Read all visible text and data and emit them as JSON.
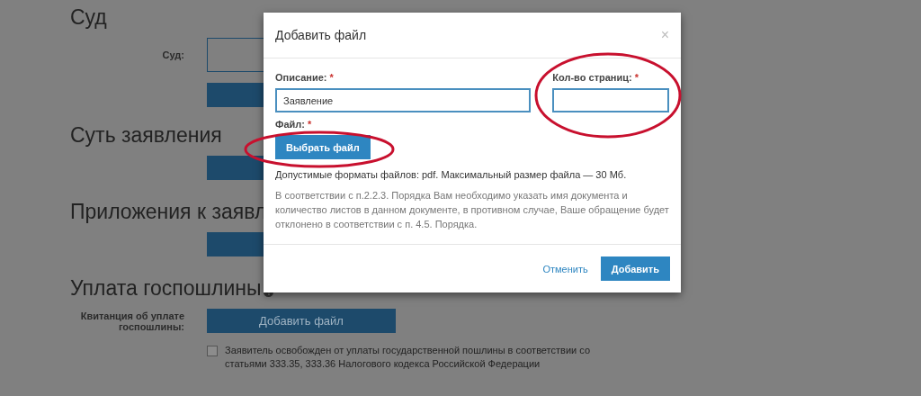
{
  "page": {
    "sections": [
      {
        "title": "Суд",
        "rows": [
          {
            "kind": "field",
            "label": "Суд:"
          },
          {
            "kind": "bar"
          }
        ]
      },
      {
        "title": "Суть заявления",
        "rows": [
          {
            "kind": "bar"
          }
        ]
      },
      {
        "title": "Приложения к заявл",
        "rows": [
          {
            "kind": "bar"
          }
        ]
      },
      {
        "title": "Уплата госпошлины",
        "help": true,
        "rows": [
          {
            "kind": "button",
            "label": "Квитанция об уплате госпошлины:",
            "button": "Добавить файл"
          },
          {
            "kind": "checkbox",
            "checked": false,
            "text": "Заявитель освобожден от уплаты государственной пошлины в соответствии со статьями 333.35, 333.36 Налогового кодекса Российской Федерации"
          }
        ]
      }
    ]
  },
  "dialog": {
    "title": "Добавить файл",
    "close": "×",
    "fields": [
      {
        "label": "Описание:",
        "required_mark": "*",
        "value": "Заявление"
      },
      {
        "label": "Кол-во страниц:",
        "required_mark": "*"
      }
    ],
    "file": {
      "label": "Файл:",
      "required_mark": "*",
      "button": "Выбрать файл"
    },
    "formats_note": "Допустимые форматы файлов: pdf. Максимальный размер файла — 30 Мб.",
    "notice": "В соответствии с п.2.2.3. Порядка Вам необходимо указать имя документа и количество листов в данном документе, в противном случае, Ваше обращение будет отклонено в соответствии с п. 4.5. Порядка.",
    "buttons": [
      {
        "kind": "link",
        "label": "Отменить"
      },
      {
        "kind": "primary",
        "label": "Добавить"
      }
    ]
  }
}
